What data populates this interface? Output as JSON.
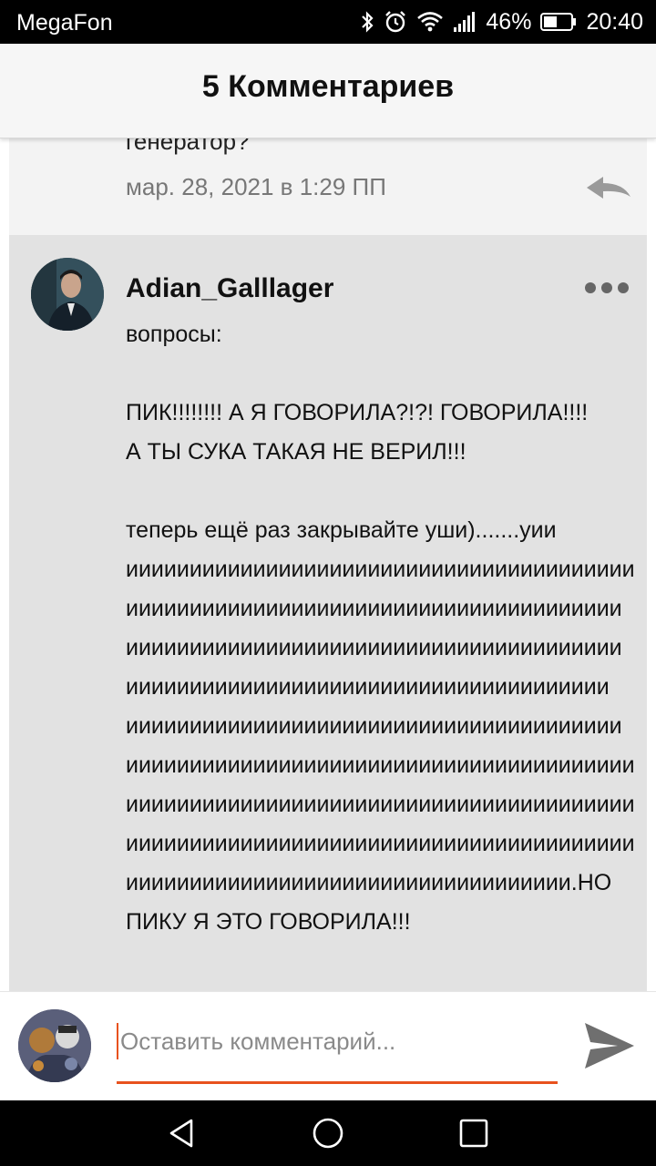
{
  "status_bar": {
    "carrier": "MegaFon",
    "battery": "46%",
    "time": "20:40"
  },
  "header": {
    "title": "5 Комментариев"
  },
  "previous_comment": {
    "text_fragment": "генератор?",
    "date": "мар. 28, 2021 в 1:29 ПП"
  },
  "comment": {
    "author": "Adian_Galllager",
    "lines": [
      "вопросы:",
      "",
      "ПИК!!!!!!!! А Я ГОВОРИЛА?!?! ГОВОРИЛА!!!!",
      "А ТЫ СУКА ТАКАЯ НЕ ВЕРИЛ!!!",
      "",
      "теперь ещё раз закрывайте уши).......уии",
      "ииииииииииииииииииииииииииииииииииииииии",
      "иииииииииииииииииииииииииииииииииииииии",
      "иииииииииииииииииииииииииииииииииииииии",
      "ииииииииииииииииииииииииииииииииииииии",
      "иииииииииииииииииииииииииииииииииииииии",
      "ииииииииииииииииииииииииииииииииииииииии",
      "ииииииииииииииииииииииииииииииииииииииии",
      "ииииииииииииииииииииииииииииииииииииииии",
      "иииииииииииииииииииииииииииииииииии.НО",
      "ПИКУ Я ЭТО ГОВОРИЛА!!!"
    ]
  },
  "input": {
    "placeholder": "Оставить комментарий..."
  },
  "colors": {
    "accent": "#e8521e",
    "comment_bg": "#e2e2e2"
  },
  "icons": {
    "reply": "reply-icon",
    "more": "more-icon",
    "send": "send-icon",
    "nav_back": "back-icon",
    "nav_home": "home-icon",
    "nav_recent": "recent-apps-icon"
  }
}
